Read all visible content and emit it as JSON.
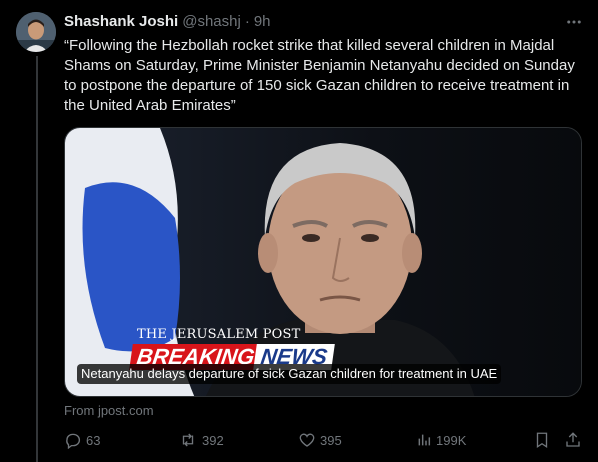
{
  "author": {
    "name": "Shashank Joshi",
    "handle": "@shashj",
    "separator": "·",
    "time": "9h"
  },
  "tweet": {
    "text": "“Following the Hezbollah rocket strike that killed several children in Majdal Shams on Saturday, Prime Minister Benjamin Netanyahu decided on Sunday to postpone the departure of 150 sick Gazan children to receive treatment in the United Arab Emirates”"
  },
  "card": {
    "watermark": "THE JERUSALEM POST",
    "breaking": "BREAKING",
    "news": "NEWS",
    "caption": "Netanyahu delays departure of sick Gazan children for treatment in UAE",
    "source": "From jpost.com"
  },
  "actions": {
    "replies": "63",
    "reposts": "392",
    "likes": "395",
    "views": "199K"
  },
  "icons": {
    "more": "more-icon",
    "reply": "reply-icon",
    "repost": "repost-icon",
    "like": "like-icon",
    "views": "views-icon",
    "bookmark": "bookmark-icon",
    "share": "share-icon"
  },
  "colors": {
    "background": "#000000",
    "text": "#e7e9ea",
    "secondary": "#71767b",
    "border": "#2f3336",
    "breaking_red": "#d8141a"
  }
}
